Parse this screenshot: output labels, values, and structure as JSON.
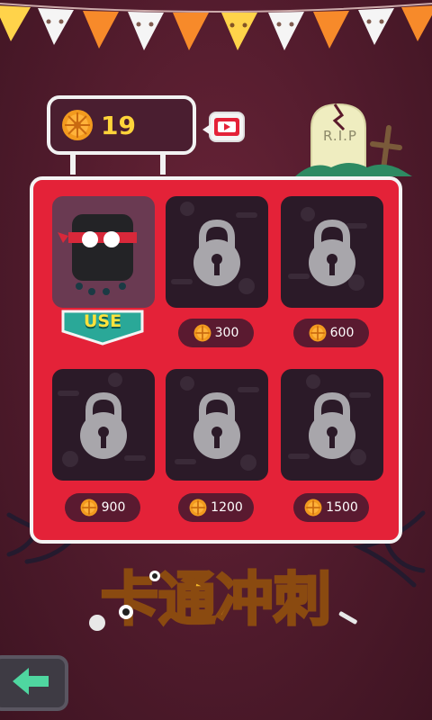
{
  "header": {
    "coins": "19",
    "tombstone_text": "R.I.P"
  },
  "shop": {
    "items": [
      {
        "state": "owned",
        "action_label": "USE"
      },
      {
        "state": "locked",
        "price": "300"
      },
      {
        "state": "locked",
        "price": "600"
      },
      {
        "state": "locked",
        "price": "900"
      },
      {
        "state": "locked",
        "price": "1200"
      },
      {
        "state": "locked",
        "price": "1500"
      }
    ]
  },
  "logo": {
    "title": "卡通冲刺"
  },
  "icons": {
    "coin": "pumpkin-coin-icon",
    "video": "video-play-icon",
    "lock": "padlock-icon",
    "back": "back-arrow-icon"
  },
  "colors": {
    "background": "#4e1a2b",
    "board": "#e42238",
    "coin_text": "#ffd43a",
    "use_badge": "#2aa898",
    "back_arrow": "#4fd6a0"
  }
}
